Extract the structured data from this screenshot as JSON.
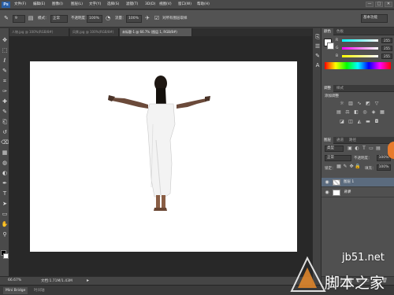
{
  "app": {
    "logo": "Ps"
  },
  "menu": [
    "文件(F)",
    "编辑(E)",
    "图像(I)",
    "图层(L)",
    "文字(Y)",
    "选择(S)",
    "滤镜(T)",
    "3D(D)",
    "视图(V)",
    "窗口(W)",
    "帮助(H)"
  ],
  "window_controls": [
    "—",
    "□",
    "✕"
  ],
  "options_bar": {
    "tool_size": "9",
    "mode_label": "模式：",
    "mode_value": "正常",
    "opacity_label": "不透明度：",
    "opacity_value": "100%",
    "flow_label": "流量：",
    "flow_value": "100%",
    "sample_label": "对所有图层取样",
    "workspace": "基本功能"
  },
  "doc_tabs": [
    {
      "label": "人物.jpg @ 100%(RGB/8#)",
      "active": false
    },
    {
      "label": "风景.jpg @ 100%(RGB/8#)",
      "active": false
    },
    {
      "label": "未标题-1 @ 66.7% (图层 1, RGB/8#)",
      "active": true
    }
  ],
  "tools": [
    "move-tool",
    "marquee-tool",
    "lasso-tool",
    "quick-select-tool",
    "crop-tool",
    "eyedropper-tool",
    "healing-tool",
    "brush-tool",
    "stamp-tool",
    "history-brush-tool",
    "eraser-tool",
    "gradient-tool",
    "blur-tool",
    "dodge-tool",
    "pen-tool",
    "type-tool",
    "path-select-tool",
    "shape-tool",
    "hand-tool",
    "zoom-tool"
  ],
  "tool_glyphs": [
    "✥",
    "⬚",
    "ℓ",
    "✎",
    "⌗",
    "✑",
    "✚",
    "✎",
    "⎗",
    "↺",
    "⌫",
    "▦",
    "◍",
    "◐",
    "✒",
    "T",
    "➤",
    "▭",
    "✋",
    "⚲"
  ],
  "color_panel": {
    "tabs": [
      "颜色",
      "色板"
    ],
    "sliders": [
      {
        "label": "R",
        "value": "255"
      },
      {
        "label": "G",
        "value": "255"
      },
      {
        "label": "B",
        "value": "255"
      }
    ]
  },
  "adjust_panel": {
    "tabs": [
      "调整",
      "样式"
    ],
    "title": "添加调整"
  },
  "layers_panel": {
    "tabs": [
      "图层",
      "通道",
      "路径"
    ],
    "kind_label": "类型",
    "blend_mode": "正常",
    "opacity_label": "不透明度：",
    "opacity_value": "100%",
    "lock_label": "锁定：",
    "fill_label": "填充：",
    "fill_value": "100%",
    "layers": [
      {
        "name": "图层 1",
        "selected": true
      },
      {
        "name": "背景",
        "selected": false
      }
    ]
  },
  "status": {
    "zoom": "66.67%",
    "doc_info": "文档:1.71M/1.43M"
  },
  "bridge": {
    "tabs": [
      "Mini Bridge",
      "时间轴"
    ]
  },
  "watermark": {
    "site": "jb51.net",
    "name": "脚本之家"
  }
}
